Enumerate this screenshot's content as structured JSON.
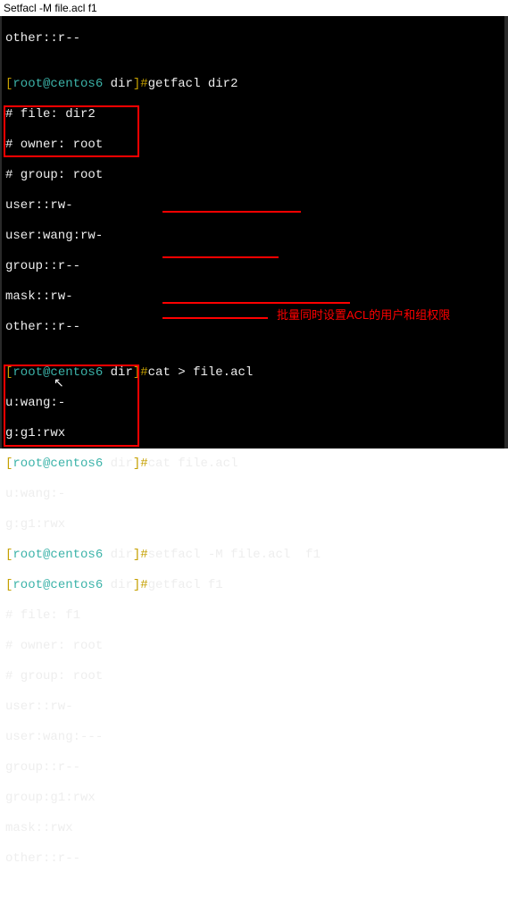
{
  "header": "Setfacl -M  file.acl  f1",
  "lines": {
    "l0": "other::r--",
    "l1": "",
    "p1_open": "[",
    "p1_user": "root@centos6",
    "p1_dir": " dir",
    "p1_close": "]#",
    "p1_cmd": "getfacl dir2",
    "l3": "# file: dir2",
    "l4": "# owner: root",
    "l5": "# group: root",
    "l6": "user::rw-",
    "l7": "user:wang:rw-",
    "l8": "group::r--",
    "l9": "mask::rw-",
    "l10": "other::r--",
    "l11": "",
    "p2_cmd": "cat > file.acl",
    "l13": "u:wang:-",
    "l14": "g:g1:rwx",
    "p3_cmd": "cat file.acl",
    "l16": "u:wang:-",
    "l17": "g:g1:rwx",
    "p4_cmd": "setfacl -M file.acl  f1",
    "p5_cmd": "getfacl f1",
    "l20": "# file: f1",
    "l21": "# owner: root",
    "l22": "# group: root",
    "l23": "user::rw-",
    "l24": "user:wang:---",
    "l25": "group::r--",
    "l26": "group:g1:rwx",
    "l27": "mask::rwx",
    "l28": "other::r--"
  },
  "annotation": "批量同时设置ACL的用户和组权限"
}
